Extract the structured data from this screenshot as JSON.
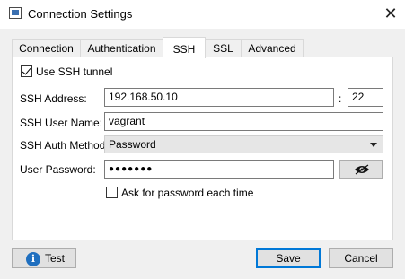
{
  "window": {
    "title": "Connection Settings",
    "close_glyph": "✕"
  },
  "tabs": [
    {
      "label": "Connection"
    },
    {
      "label": "Authentication"
    },
    {
      "label": "SSH",
      "active": true
    },
    {
      "label": "SSL"
    },
    {
      "label": "Advanced"
    }
  ],
  "ssh": {
    "use_tunnel_label": "Use SSH tunnel",
    "use_tunnel_checked": true,
    "address_label": "SSH Address:",
    "address_value": "192.168.50.10",
    "port_separator": ":",
    "port_value": "22",
    "user_label": "SSH User Name:",
    "user_value": "vagrant",
    "auth_method_label": "SSH Auth Method:",
    "auth_method_value": "Password",
    "password_label": "User Password:",
    "password_value": "●●●●●●●",
    "ask_password_label": "Ask for password each time",
    "ask_password_checked": false
  },
  "footer": {
    "test_label": "Test",
    "save_label": "Save",
    "cancel_label": "Cancel"
  },
  "icons": {
    "app": "window-icon",
    "info": "info-icon",
    "eye": "eye-icon"
  },
  "colors": {
    "accent": "#0078d7",
    "info_blue": "#1f6fbf"
  }
}
